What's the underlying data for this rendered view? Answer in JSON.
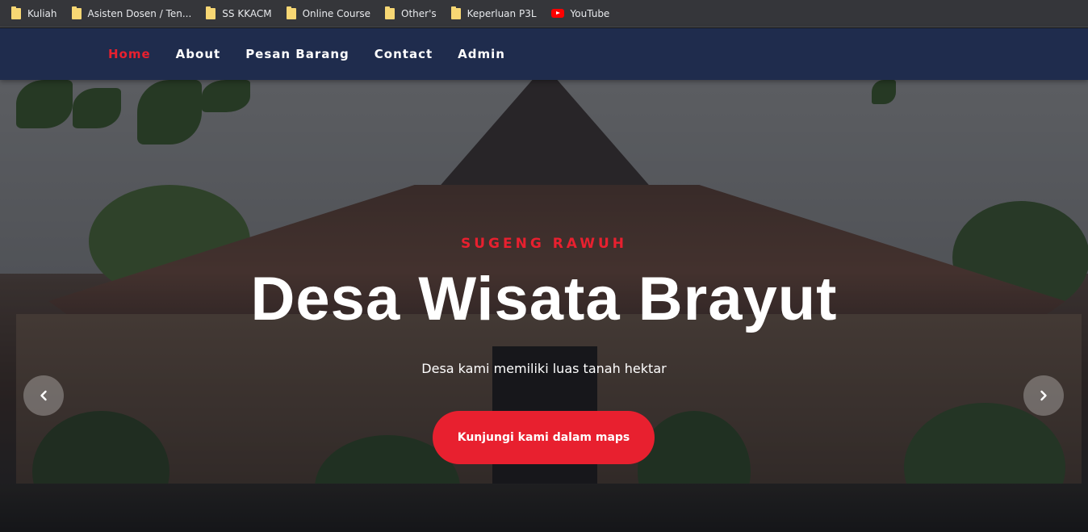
{
  "bookmarks": [
    {
      "label": "Kuliah",
      "icon": "folder-icon"
    },
    {
      "label": "Asisten Dosen / Ten...",
      "icon": "folder-icon"
    },
    {
      "label": "SS KKACM",
      "icon": "folder-icon"
    },
    {
      "label": "Online Course",
      "icon": "folder-icon"
    },
    {
      "label": "Other's",
      "icon": "folder-icon"
    },
    {
      "label": "Keperluan P3L",
      "icon": "folder-icon"
    },
    {
      "label": "YouTube",
      "icon": "youtube-icon"
    }
  ],
  "nav": {
    "items": [
      {
        "label": "Home",
        "active": true
      },
      {
        "label": "About",
        "active": false
      },
      {
        "label": "Pesan Barang",
        "active": false
      },
      {
        "label": "Contact",
        "active": false
      },
      {
        "label": "Admin",
        "active": false
      }
    ]
  },
  "hero": {
    "tagline": "SUGENG RAWUH",
    "title": "Desa Wisata Brayut",
    "subtitle": "Desa kami memiliki luas tanah hektar",
    "cta_label": "Kunjungi kami dalam maps",
    "prev_icon": "chevron-left-icon",
    "next_icon": "chevron-right-icon"
  },
  "colors": {
    "accent": "#e8202f",
    "navbar_bg": "#1f2c4d",
    "bookmarks_bg": "#35363a"
  }
}
